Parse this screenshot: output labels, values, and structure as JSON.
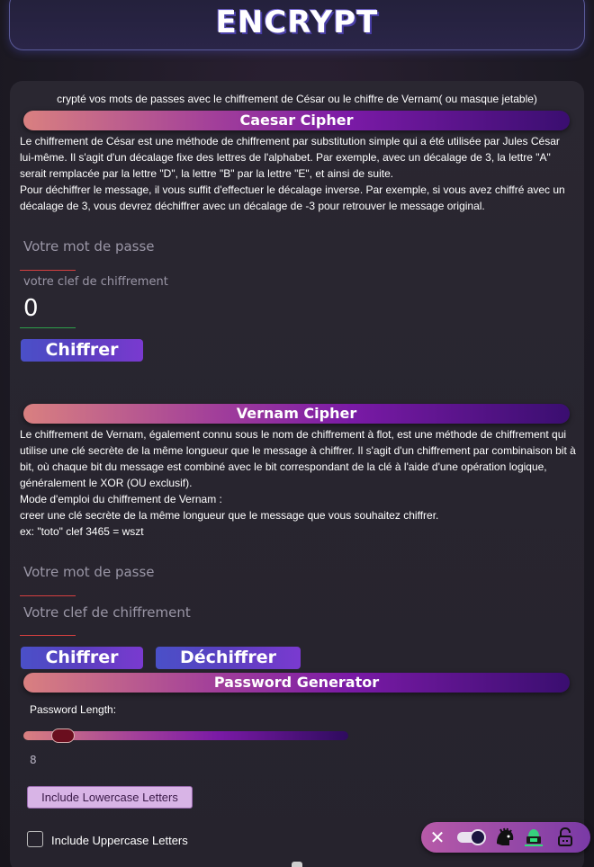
{
  "header": {
    "title": "ENCRYPT"
  },
  "intro": "crypté vos mots de passes avec le chiffrement de César ou le chiffre de Vernam( ou masque jetable)",
  "caesar": {
    "title": "Caesar Cipher",
    "description": [
      "Le chiffrement de César est une méthode de chiffrement par substitution simple qui a été utilisée par Jules César lui-même. Il s'agit d'un décalage fixe des lettres de l'alphabet. Par exemple, avec un décalage de 3, la lettre \"A\" serait remplacée par la lettre \"D\", la lettre \"B\" par la lettre \"E\", et ainsi de suite.",
      "Pour déchiffrer le message, il vous suffit d'effectuer le décalage inverse. Par exemple, si vous avez chiffré avec un décalage de 3, vous devrez déchiffrer avec un décalage de -3 pour retrouver le message original."
    ],
    "password_placeholder": "Votre mot de passe",
    "key_label": "votre clef de chiffrement",
    "key_value": "0",
    "encrypt_button": "Chiffrer"
  },
  "vernam": {
    "title": "Vernam Cipher",
    "description": [
      "Le chiffrement de Vernam, également connu sous le nom de chiffrement à flot, est une méthode de chiffrement qui utilise une clé secrète de la même longueur que le message à chiffrer. Il s'agit d'un chiffrement par combinaison bit à bit, où chaque bit du message est combiné avec le bit correspondant de la clé à l'aide d'une opération logique, généralement le XOR (OU exclusif).",
      "Mode d'emploi du chiffrement de Vernam :",
      "creer une clé secrète de la même longueur que le message que vous souhaitez chiffrer.",
      "ex: \"toto\" clef 3465 = wszt"
    ],
    "password_placeholder": "Votre mot de passe",
    "key_placeholder": "Votre clef de chiffrement",
    "encrypt_button": "Chiffrer",
    "decrypt_button": "Déchiffrer"
  },
  "generator": {
    "title": "Password Generator",
    "length_label": "Password Length:",
    "length_value": "8",
    "length_fraction": 0.1,
    "lowercase_button": "Include Lowercase Letters",
    "uppercase_label": "Include Uppercase Letters",
    "uppercase_checked": false
  },
  "toolbar": {
    "close_icon": "close-icon",
    "toggle_icon": "dark-mode-toggle-icon",
    "icons": [
      "helmet-icon",
      "hacker-icon",
      "lock-icon"
    ]
  },
  "colors": {
    "accent_gradient_start": "#d98080",
    "accent_gradient_mid": "#7a1aa6",
    "accent_gradient_end": "#3a0e70",
    "button_blue": "#4a50c8",
    "error_underline": "#d64040",
    "ok_underline": "#2ea04a"
  }
}
